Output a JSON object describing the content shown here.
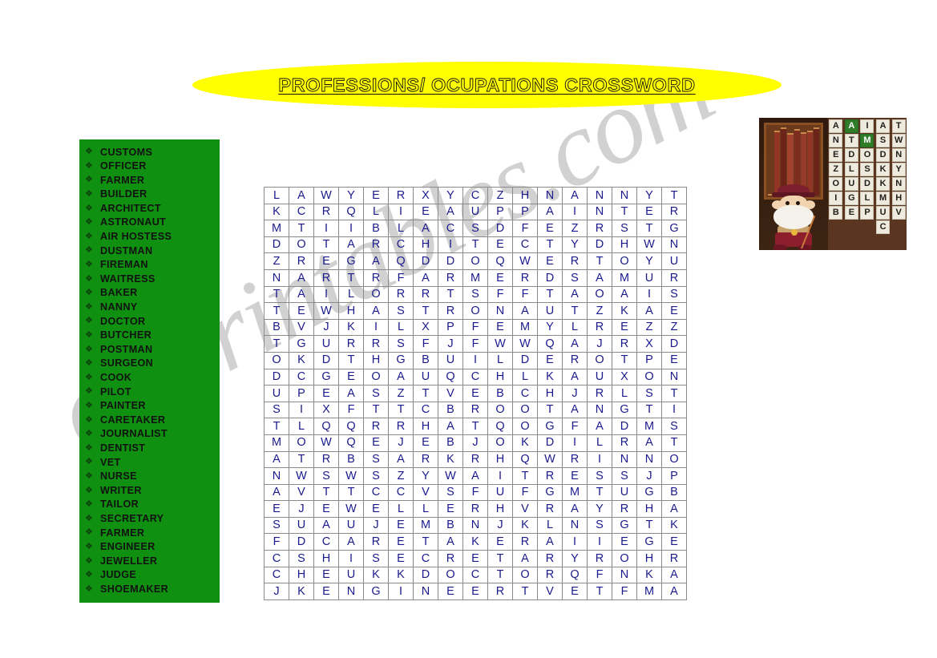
{
  "title": {
    "text": "PROFESSIONS/ OCUPATIONS CROSSWORD",
    "banner_color": "#ffff00",
    "text_outline_color": "#111111"
  },
  "watermark": {
    "text": "eslprintables.com",
    "color": "#c9c9c9"
  },
  "wordlist": {
    "panel_color": "#109010",
    "bullet": "❖",
    "items": [
      "CUSTOMS",
      "OFFICER",
      "FARMER",
      "BUILDER",
      "ARCHITECT",
      "ASTRONAUT",
      "AIR HOSTESS",
      "DUSTMAN",
      "FIREMAN",
      "WAITRESS",
      "BAKER",
      "NANNY",
      "DOCTOR",
      "BUTCHER",
      "POSTMAN",
      "SURGEON",
      "COOK",
      "PILOT",
      "PAINTER",
      "CARETAKER",
      "JOURNALIST",
      "DENTIST",
      "VET",
      "NURSE",
      "WRITER",
      "TAILOR",
      "SECRETARY",
      "FARMER",
      "ENGINEER",
      "JEWELLER",
      "JUDGE",
      "SHOEMAKER"
    ]
  },
  "puzzle": {
    "columns": 17,
    "rows": 25,
    "letter_color": "#1a1a8c",
    "grid": [
      [
        "L",
        "A",
        "W",
        "Y",
        "E",
        "R",
        "X",
        "Y",
        "C",
        "Z",
        "H",
        "N",
        "A",
        "N",
        "N",
        "Y",
        "T"
      ],
      [
        "K",
        "C",
        "R",
        "Q",
        "L",
        "I",
        "E",
        "A",
        "U",
        "P",
        "P",
        "A",
        "I",
        "N",
        "T",
        "E",
        "R"
      ],
      [
        "M",
        "T",
        "I",
        "I",
        "B",
        "L",
        "A",
        "C",
        "S",
        "D",
        "F",
        "E",
        "Z",
        "R",
        "S",
        "T",
        "G"
      ],
      [
        "D",
        "O",
        "T",
        "A",
        "R",
        "C",
        "H",
        "I",
        "T",
        "E",
        "C",
        "T",
        "Y",
        "D",
        "H",
        "W",
        "N"
      ],
      [
        "Z",
        "R",
        "E",
        "G",
        "A",
        "Q",
        "D",
        "D",
        "O",
        "Q",
        "W",
        "E",
        "R",
        "T",
        "O",
        "Y",
        "U"
      ],
      [
        "N",
        "A",
        "R",
        "T",
        "R",
        "F",
        "A",
        "R",
        "M",
        "E",
        "R",
        "D",
        "S",
        "A",
        "M",
        "U",
        "R"
      ],
      [
        "T",
        "A",
        "I",
        "L",
        "O",
        "R",
        "R",
        "T",
        "S",
        "F",
        "F",
        "T",
        "A",
        "O",
        "A",
        "I",
        "S"
      ],
      [
        "T",
        "E",
        "W",
        "H",
        "A",
        "S",
        "T",
        "R",
        "O",
        "N",
        "A",
        "U",
        "T",
        "Z",
        "K",
        "A",
        "E"
      ],
      [
        "B",
        "V",
        "J",
        "K",
        "I",
        "L",
        "X",
        "P",
        "F",
        "E",
        "M",
        "Y",
        "L",
        "R",
        "E",
        "Z",
        "Z"
      ],
      [
        "T",
        "G",
        "U",
        "R",
        "R",
        "S",
        "F",
        "J",
        "F",
        "W",
        "W",
        "Q",
        "A",
        "J",
        "R",
        "X",
        "D"
      ],
      [
        "O",
        "K",
        "D",
        "T",
        "H",
        "G",
        "B",
        "U",
        "I",
        "L",
        "D",
        "E",
        "R",
        "O",
        "T",
        "P",
        "E"
      ],
      [
        "D",
        "C",
        "G",
        "E",
        "O",
        "A",
        "U",
        "Q",
        "C",
        "H",
        "L",
        "K",
        "A",
        "U",
        "X",
        "O",
        "N"
      ],
      [
        "U",
        "P",
        "E",
        "A",
        "S",
        "Z",
        "T",
        "V",
        "E",
        "B",
        "C",
        "H",
        "J",
        "R",
        "L",
        "S",
        "T"
      ],
      [
        "S",
        "I",
        "X",
        "F",
        "T",
        "T",
        "C",
        "B",
        "R",
        "O",
        "O",
        "T",
        "A",
        "N",
        "G",
        "T",
        "I"
      ],
      [
        "T",
        "L",
        "Q",
        "Q",
        "R",
        "R",
        "H",
        "A",
        "T",
        "Q",
        "O",
        "G",
        "F",
        "A",
        "D",
        "M",
        "S"
      ],
      [
        "M",
        "O",
        "W",
        "Q",
        "E",
        "J",
        "E",
        "B",
        "J",
        "O",
        "K",
        "D",
        "I",
        "L",
        "R",
        "A",
        "T"
      ],
      [
        "A",
        "T",
        "R",
        "B",
        "S",
        "A",
        "R",
        "K",
        "R",
        "H",
        "Q",
        "W",
        "R",
        "I",
        "N",
        "N",
        "O"
      ],
      [
        "N",
        "W",
        "S",
        "W",
        "S",
        "Z",
        "Y",
        "W",
        "A",
        "I",
        "T",
        "R",
        "E",
        "S",
        "S",
        "J",
        "P"
      ],
      [
        "A",
        "V",
        "T",
        "T",
        "C",
        "C",
        "V",
        "S",
        "F",
        "U",
        "F",
        "G",
        "M",
        "T",
        "U",
        "G",
        "B"
      ],
      [
        "E",
        "J",
        "E",
        "W",
        "E",
        "L",
        "L",
        "E",
        "R",
        "H",
        "V",
        "R",
        "A",
        "Y",
        "R",
        "H",
        "A"
      ],
      [
        "S",
        "U",
        "A",
        "U",
        "J",
        "E",
        "M",
        "B",
        "N",
        "J",
        "K",
        "L",
        "N",
        "S",
        "G",
        "T",
        "K"
      ],
      [
        "F",
        "D",
        "C",
        "A",
        "R",
        "E",
        "T",
        "A",
        "K",
        "E",
        "R",
        "A",
        "I",
        "I",
        "E",
        "G",
        "E"
      ],
      [
        "C",
        "S",
        "H",
        "I",
        "S",
        "E",
        "C",
        "R",
        "E",
        "T",
        "A",
        "R",
        "Y",
        "R",
        "O",
        "H",
        "R"
      ],
      [
        "C",
        "H",
        "E",
        "U",
        "K",
        "K",
        "D",
        "O",
        "C",
        "T",
        "O",
        "R",
        "Q",
        "F",
        "N",
        "K",
        "A"
      ],
      [
        "J",
        "K",
        "E",
        "N",
        "G",
        "I",
        "N",
        "E",
        "E",
        "R",
        "T",
        "V",
        "E",
        "T",
        "F",
        "M",
        "A"
      ]
    ]
  },
  "thumbnail": {
    "description": "wizard-in-library-word-game",
    "tile_columns": [
      {
        "letters": [
          "A",
          "N",
          "E",
          "Z",
          "O",
          "I",
          "B"
        ],
        "highlight_index": -1
      },
      {
        "letters": [
          "A",
          "T",
          "D",
          "L",
          "U",
          "G",
          "E"
        ],
        "highlight_index": 0
      },
      {
        "letters": [
          "I",
          "M",
          "O",
          "S",
          "D",
          "L",
          "P"
        ],
        "highlight_index": 1
      },
      {
        "letters": [
          "A",
          "S",
          "D",
          "K",
          "K",
          "M",
          "U",
          "C"
        ],
        "highlight_index": -1
      },
      {
        "letters": [
          "T",
          "W",
          "N",
          "Y",
          "N",
          "H",
          "V"
        ],
        "highlight_index": -1
      }
    ]
  }
}
